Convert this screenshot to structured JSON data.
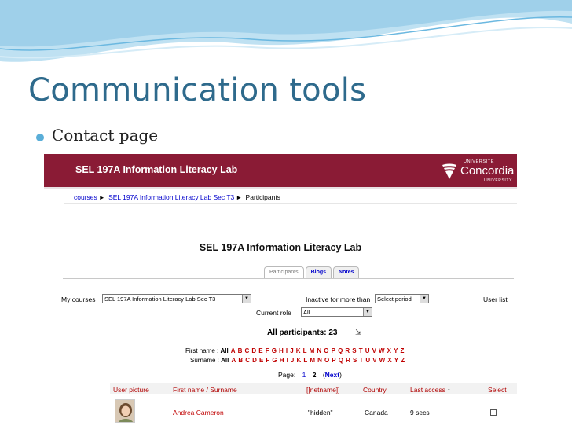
{
  "slide": {
    "title": "Communication tools",
    "bullet": "Contact page"
  },
  "colors": {
    "title": "#2e6a8c",
    "banner": "#8a1b35",
    "link": "#0000cc",
    "letter": "#c00000"
  },
  "screenshot": {
    "header_title": "SEL 197A Information Literacy Lab",
    "logo": {
      "upper": "UNIVERSITÉ",
      "name": "Concordia",
      "lower": "UNIVERSITY"
    },
    "breadcrumb": [
      {
        "label": "courses",
        "link": true
      },
      {
        "label": "SEL 197A Information Literacy Lab Sec T3",
        "link": true
      },
      {
        "label": "Participants",
        "link": false
      }
    ],
    "breadcrumb_sep": "►",
    "course_heading": "SEL 197A Information Literacy Lab",
    "tabs": [
      "Participants",
      "Blogs",
      "Notes"
    ],
    "controls": {
      "my_courses_label": "My courses",
      "my_courses_value": "SEL 197A Information Literacy Lab Sec T3",
      "inactive_label": "Inactive for more than",
      "inactive_value": "Select period",
      "user_list_label": "User list",
      "current_role_label": "Current role",
      "current_role_value": "All"
    },
    "participants_label": "All participants: 23",
    "participants_icon": "toggle-icon",
    "first_name_label": "First name :",
    "surname_label": "Surname :",
    "all_label": "All",
    "letters": [
      "A",
      "B",
      "C",
      "D",
      "E",
      "F",
      "G",
      "H",
      "I",
      "J",
      "K",
      "L",
      "M",
      "N",
      "O",
      "P",
      "Q",
      "R",
      "S",
      "T",
      "U",
      "V",
      "W",
      "X",
      "Y",
      "Z"
    ],
    "pages": {
      "label": "Page:",
      "items": [
        "1",
        "2"
      ],
      "next": "(Next)",
      "next_text": "Next"
    },
    "table": {
      "headers": [
        "User picture",
        "First name / Surname",
        "[[netname]]",
        "Country",
        "Last access",
        "Select"
      ],
      "sort_arrow": "↑",
      "rows": [
        {
          "name": "Andrea Cameron",
          "netname": "\"hidden\"",
          "country": "Canada",
          "last_access": "9 secs"
        }
      ]
    }
  }
}
